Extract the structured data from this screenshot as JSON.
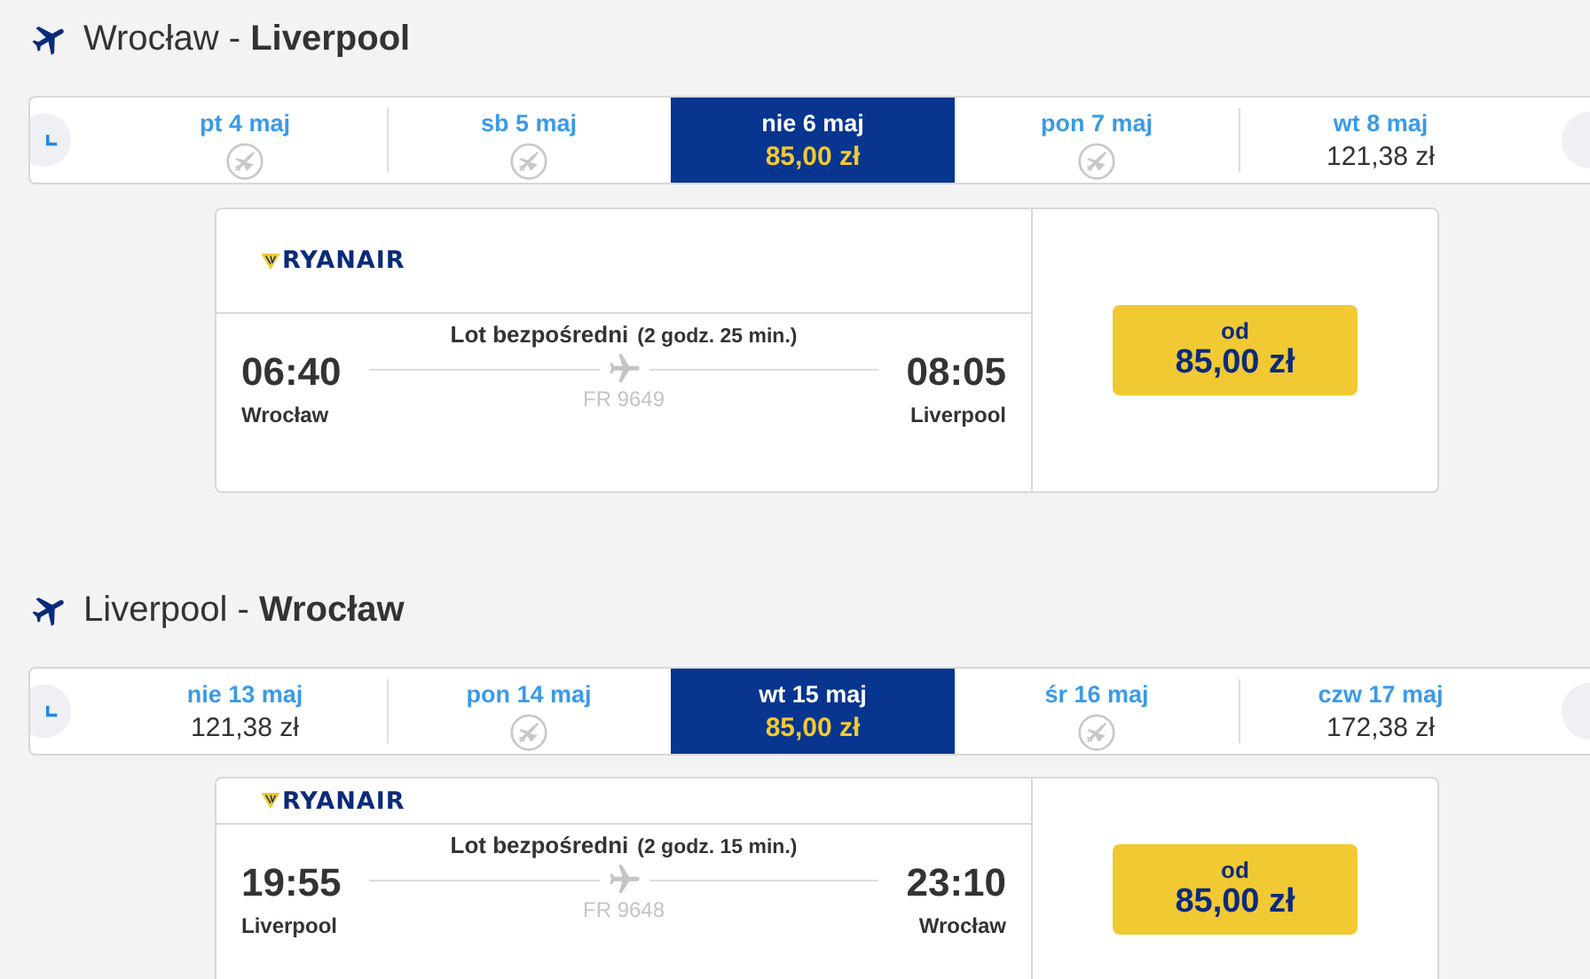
{
  "sections": [
    {
      "title": "Wrocław - **Liverpool**",
      "dates": [
        {
          "date": "pt 4 maj",
          "selected": false
        },
        {
          "date": "sb 5 maj",
          "selected": false
        },
        {
          "date": "nie 6 maj",
          "price": "85,00 zł",
          "selected": true
        },
        {
          "date": "pon 7 maj",
          "selected": false
        },
        {
          "date": "wt 8 maj",
          "price": "121,38 zł",
          "selected": false
        }
      ],
      "flight": {
        "airline": "RYANAIR",
        "type": "Lot bezpośredni",
        "duration": "(2 godz. 25 min.)",
        "departure_time": "06:40",
        "departure_city": "Wrocław",
        "arrival_time": "08:05",
        "arrival_city": "Liverpool",
        "flight_number": "FR 9649",
        "price_label": "od",
        "price": "85,00 zł"
      }
    },
    {
      "title": "Liverpool - **Wrocław**",
      "dates": [
        {
          "date": "nie 13 maj",
          "price": "121,38 zł",
          "selected": false
        },
        {
          "date": "pon 14 maj",
          "selected": false
        },
        {
          "date": "wt 15 maj",
          "price": "85,00 zł",
          "selected": true
        },
        {
          "date": "śr 16 maj",
          "selected": false
        },
        {
          "date": "czw 17 maj",
          "price": "172,38 zł",
          "selected": false
        }
      ],
      "flight": {
        "airline": "RYANAIR",
        "type": "Lot bezpośredni",
        "duration": "(2 godz. 15 min.)",
        "departure_time": "19:55",
        "departure_city": "Liverpool",
        "arrival_time": "23:10",
        "arrival_city": "Wrocław",
        "flight_number": "FR 9648",
        "price_label": "od",
        "price": "85,00 zł"
      }
    }
  ]
}
